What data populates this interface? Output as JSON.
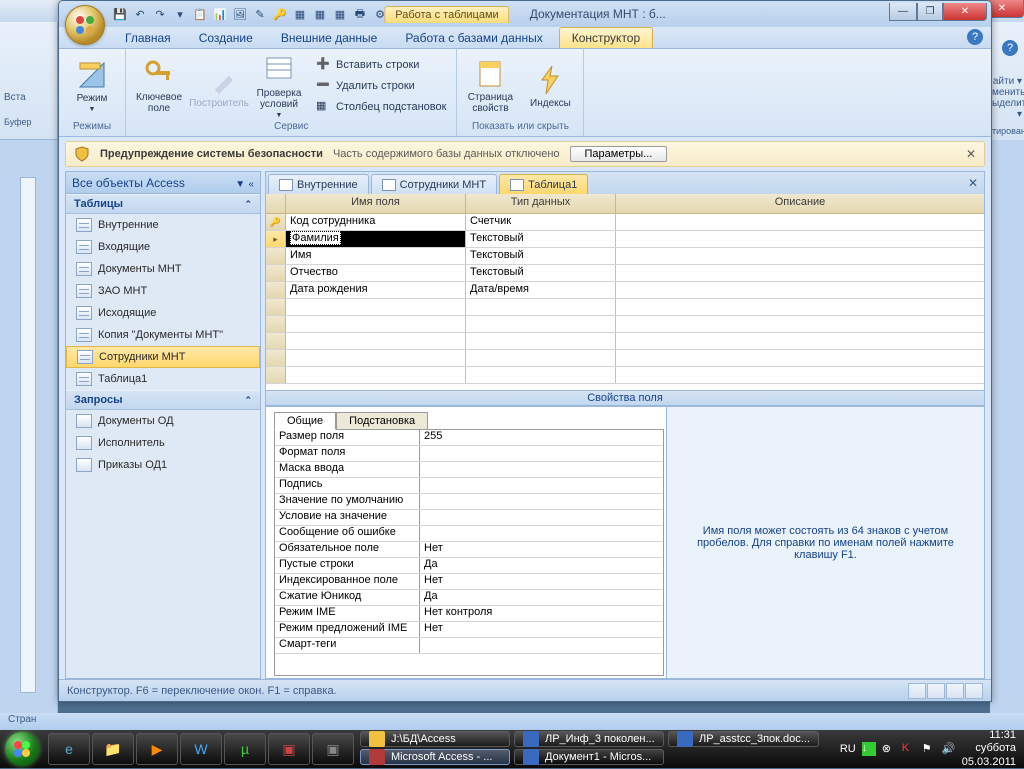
{
  "bg_window": {
    "title_fragment": ""
  },
  "word_fragments": {
    "left": [
      "Вста",
      "Буфер"
    ],
    "right": [
      "айти ▾",
      "менить",
      "ыделить ▾",
      "тирование"
    ]
  },
  "access": {
    "qat_context_label": "Работа с таблицами",
    "doc_title": "Документация МНТ : б...",
    "ribbon_tabs": [
      "Главная",
      "Создание",
      "Внешние данные",
      "Работа с базами данных",
      "Конструктор"
    ],
    "active_tab_index": 4,
    "ribbon": {
      "groups": [
        {
          "label": "Режимы",
          "big": [
            {
              "t": "Режим",
              "arrow": true
            }
          ]
        },
        {
          "label": "Сервис",
          "big": [
            {
              "t": "Ключевое поле"
            },
            {
              "t": "Построитель",
              "disabled": true
            },
            {
              "t": "Проверка условий",
              "arrow": true
            }
          ],
          "small": [
            "Вставить строки",
            "Удалить строки",
            "Столбец подстановок"
          ]
        },
        {
          "label": "Показать или скрыть",
          "big": [
            {
              "t": "Страница свойств"
            },
            {
              "t": "Индексы"
            }
          ]
        }
      ]
    },
    "security": {
      "bold": "Предупреждение системы безопасности",
      "msg": "Часть содержимого базы данных отключено",
      "btn": "Параметры..."
    },
    "nav": {
      "header": "Все объекты Access",
      "groups": [
        {
          "title": "Таблицы",
          "items": [
            "Внутренние",
            "Входящие",
            "Документы МНТ",
            "ЗАО МНТ",
            "Исходящие",
            "Копия \"Документы МНТ\"",
            "Сотрудники МНТ",
            "Таблица1"
          ],
          "selected_index": 6,
          "icon": "table"
        },
        {
          "title": "Запросы",
          "items": [
            "Документы ОД",
            "Исполнитель",
            "Приказы ОД1"
          ],
          "icon": "query"
        }
      ]
    },
    "doctabs": [
      {
        "label": "Внутренние"
      },
      {
        "label": "Сотрудники МНТ"
      },
      {
        "label": "Таблица1",
        "active": true
      }
    ],
    "grid": {
      "headers": [
        "Имя поля",
        "Тип данных",
        "Описание"
      ],
      "rows": [
        {
          "key": "🔑",
          "name": "Код сотруднника",
          "type": "Счетчик"
        },
        {
          "sel": true,
          "name": "Фамилия",
          "type": "Текстовый"
        },
        {
          "name": "Имя",
          "type": "Текстовый"
        },
        {
          "name": "Отчество",
          "type": "Текстовый"
        },
        {
          "name": "Дата рождения",
          "type": "Дата/время"
        }
      ],
      "empty_rows": 5
    },
    "splitter_label": "Свойства поля",
    "prop_tabs": [
      "Общие",
      "Подстановка"
    ],
    "props": [
      {
        "n": "Размер поля",
        "v": "255"
      },
      {
        "n": "Формат поля",
        "v": ""
      },
      {
        "n": "Маска ввода",
        "v": ""
      },
      {
        "n": "Подпись",
        "v": ""
      },
      {
        "n": "Значение по умолчанию",
        "v": ""
      },
      {
        "n": "Условие на значение",
        "v": ""
      },
      {
        "n": "Сообщение об ошибке",
        "v": ""
      },
      {
        "n": "Обязательное поле",
        "v": "Нет"
      },
      {
        "n": "Пустые строки",
        "v": "Да"
      },
      {
        "n": "Индексированное поле",
        "v": "Нет"
      },
      {
        "n": "Сжатие Юникод",
        "v": "Да"
      },
      {
        "n": "Режим IME",
        "v": "Нет контроля"
      },
      {
        "n": "Режим предложений IME",
        "v": "Нет"
      },
      {
        "n": "Смарт-теги",
        "v": ""
      }
    ],
    "hint": "Имя поля может состоять из 64 знаков с учетом пробелов.  Для справки по именам полей нажмите клавишу F1.",
    "status": "Конструктор.  F6 = переключение окон.  F1 = справка."
  },
  "word_status": "Стран",
  "taskbar": {
    "items": [
      {
        "label": "J:\\БД\\Access",
        "ico": "#f0c040"
      },
      {
        "label": "ЛР_Инф_3 поколен...",
        "ico": "#3a6ac0"
      },
      {
        "label": "ЛР_asstcc_3пок.doc...",
        "ico": "#3a6ac0"
      },
      {
        "label": "Microsoft Access - ...",
        "ico": "#b03a3a",
        "row2": true,
        "active": true
      },
      {
        "label": "Документ1 - Micros...",
        "ico": "#3a6ac0",
        "row2": true
      }
    ],
    "lang": "RU",
    "time": "11:31",
    "date": "05.03.2011",
    "day": "суббота"
  }
}
